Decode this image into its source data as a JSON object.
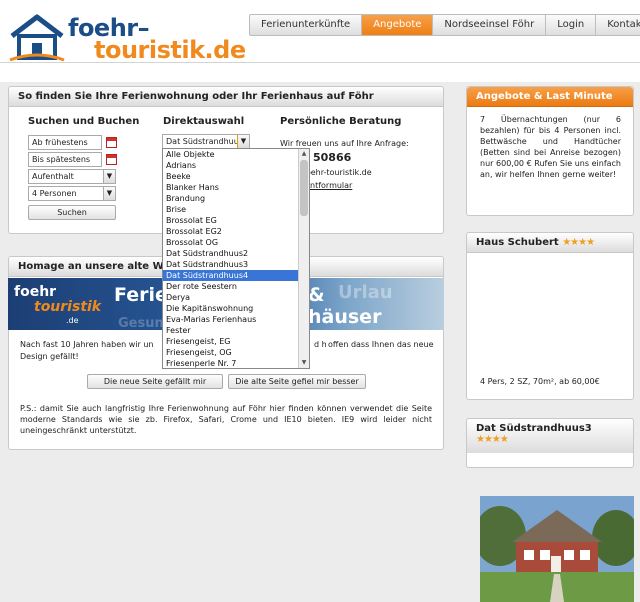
{
  "brand": {
    "line1": "foehr–",
    "line2": "touristik.de"
  },
  "nav": [
    {
      "label": "Ferienunterkünfte",
      "active": false
    },
    {
      "label": "Angebote",
      "active": true
    },
    {
      "label": "Nordseeinsel Föhr",
      "active": false
    },
    {
      "label": "Login",
      "active": false
    },
    {
      "label": "Kontakt",
      "active": false
    }
  ],
  "search_panel": {
    "title": "So finden Sie Ihre Ferienwohnung oder Ihr Ferienhaus auf Föhr",
    "col1": {
      "title": "Suchen und Buchen",
      "from_value": "Ab frühestens",
      "to_value": "Bis spätestens",
      "stay_value": "Aufenthalt",
      "persons_value": "4 Personen",
      "search_button": "Suchen"
    },
    "col2": {
      "title": "Direktauswahl",
      "selected": "Dat Südstrandhuus4"
    },
    "col3": {
      "title": "Persönliche Beratung",
      "intro": "Wir freuen uns auf Ihre Anfrage:",
      "phone": "50866",
      "email_partial": "foehr-touristik.de",
      "form_link_partial": "ntformular"
    }
  },
  "dropdown_options": [
    "Alle Objekte",
    "Adrians",
    "Beeke",
    "Blanker Hans",
    "Brandung",
    "Brise",
    "Brossolat EG",
    "Brossolat EG2",
    "Brossolat OG",
    "Dat Südstrandhuus2",
    "Dat Südstrandhuus3",
    "Dat Südstrandhuus4",
    "Der rote Seestern",
    "Derya",
    "Die Kapitänswohnung",
    "Eva-Marias Ferienhaus",
    "Fester",
    "Friesengeist, EG",
    "Friesengeist, OG",
    "Friesenperle Nr. 7"
  ],
  "dropdown_highlighted_index": 11,
  "homage_panel": {
    "title_partial": "Homage an unsere alte We",
    "banner": {
      "logo1": "foehr",
      "logo2": "touristik",
      "logo3": ".de",
      "title1_partial": "Ferie",
      "title2_partial": "häuser",
      "amp": "&",
      "ghost1": "Urlau",
      "ghost2": "Gesun"
    },
    "text_left": "Nach fast 10 Jahren haben wir un",
    "text_right": "offen dass Ihnen das neue",
    "text_line2": "Design gefällt!",
    "text_mid_partial": "d h",
    "btn_like": "Die neue Seite gefällt mir",
    "btn_prefer_old": "Die alte Seite gefiel mir besser",
    "ps_text": "P.S.: damit Sie auch langfristig Ihre Ferienwohnung auf Föhr hier finden können verwendet die Seite moderne Standards wie sie zb. Firefox, Safari, Crome und IE10 bieten. IE9 wird leider nicht uneingeschränkt unterstützt."
  },
  "offer_panel": {
    "title": "Angebote & Last Minute",
    "text": "7 Übernachtungen (nur 6 bezahlen) für bis 4 Personen incl. Bettwäsche und Handtücher (Betten sind bei Anreise bezogen) nur 600,00 € Rufen Sie uns einfach an, wir helfen Ihnen gerne weiter!"
  },
  "house_panel": {
    "title": "Haus Schubert",
    "stars": "★★★★",
    "rating": 4,
    "details": "4 Pers, 2 SZ, 70m², ab 60,00€"
  },
  "house2_panel": {
    "title": "Dat Südstrandhuus3",
    "stars": "★★★★",
    "rating": 4
  },
  "colors": {
    "accent_orange": "#ee7f14",
    "brand_blue": "#1b4d86",
    "highlight_blue": "#3875d7"
  }
}
